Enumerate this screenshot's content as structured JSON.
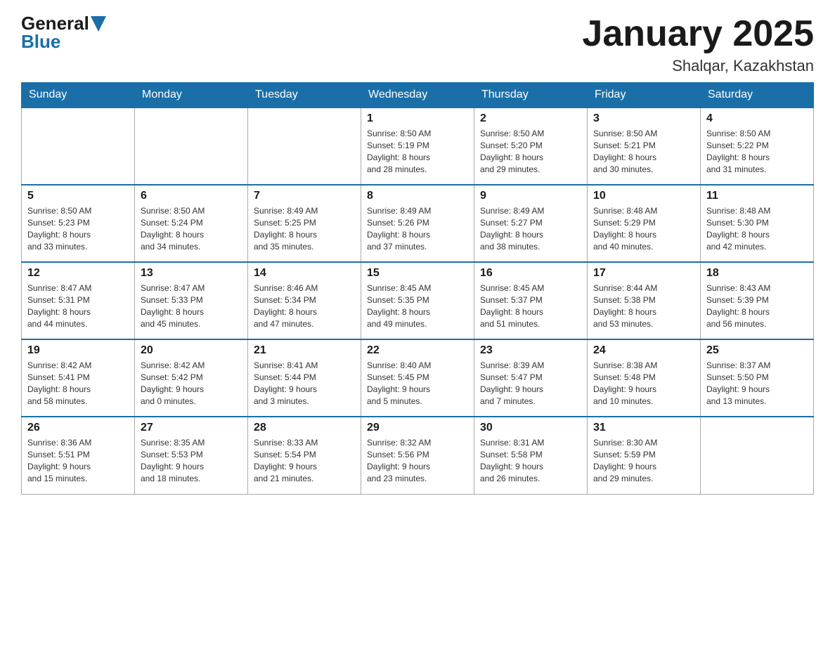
{
  "header": {
    "logo_general": "General",
    "logo_blue": "Blue",
    "month_title": "January 2025",
    "location": "Shalqar, Kazakhstan"
  },
  "weekdays": [
    "Sunday",
    "Monday",
    "Tuesday",
    "Wednesday",
    "Thursday",
    "Friday",
    "Saturday"
  ],
  "weeks": [
    [
      {
        "day": "",
        "info": ""
      },
      {
        "day": "",
        "info": ""
      },
      {
        "day": "",
        "info": ""
      },
      {
        "day": "1",
        "info": "Sunrise: 8:50 AM\nSunset: 5:19 PM\nDaylight: 8 hours\nand 28 minutes."
      },
      {
        "day": "2",
        "info": "Sunrise: 8:50 AM\nSunset: 5:20 PM\nDaylight: 8 hours\nand 29 minutes."
      },
      {
        "day": "3",
        "info": "Sunrise: 8:50 AM\nSunset: 5:21 PM\nDaylight: 8 hours\nand 30 minutes."
      },
      {
        "day": "4",
        "info": "Sunrise: 8:50 AM\nSunset: 5:22 PM\nDaylight: 8 hours\nand 31 minutes."
      }
    ],
    [
      {
        "day": "5",
        "info": "Sunrise: 8:50 AM\nSunset: 5:23 PM\nDaylight: 8 hours\nand 33 minutes."
      },
      {
        "day": "6",
        "info": "Sunrise: 8:50 AM\nSunset: 5:24 PM\nDaylight: 8 hours\nand 34 minutes."
      },
      {
        "day": "7",
        "info": "Sunrise: 8:49 AM\nSunset: 5:25 PM\nDaylight: 8 hours\nand 35 minutes."
      },
      {
        "day": "8",
        "info": "Sunrise: 8:49 AM\nSunset: 5:26 PM\nDaylight: 8 hours\nand 37 minutes."
      },
      {
        "day": "9",
        "info": "Sunrise: 8:49 AM\nSunset: 5:27 PM\nDaylight: 8 hours\nand 38 minutes."
      },
      {
        "day": "10",
        "info": "Sunrise: 8:48 AM\nSunset: 5:29 PM\nDaylight: 8 hours\nand 40 minutes."
      },
      {
        "day": "11",
        "info": "Sunrise: 8:48 AM\nSunset: 5:30 PM\nDaylight: 8 hours\nand 42 minutes."
      }
    ],
    [
      {
        "day": "12",
        "info": "Sunrise: 8:47 AM\nSunset: 5:31 PM\nDaylight: 8 hours\nand 44 minutes."
      },
      {
        "day": "13",
        "info": "Sunrise: 8:47 AM\nSunset: 5:33 PM\nDaylight: 8 hours\nand 45 minutes."
      },
      {
        "day": "14",
        "info": "Sunrise: 8:46 AM\nSunset: 5:34 PM\nDaylight: 8 hours\nand 47 minutes."
      },
      {
        "day": "15",
        "info": "Sunrise: 8:45 AM\nSunset: 5:35 PM\nDaylight: 8 hours\nand 49 minutes."
      },
      {
        "day": "16",
        "info": "Sunrise: 8:45 AM\nSunset: 5:37 PM\nDaylight: 8 hours\nand 51 minutes."
      },
      {
        "day": "17",
        "info": "Sunrise: 8:44 AM\nSunset: 5:38 PM\nDaylight: 8 hours\nand 53 minutes."
      },
      {
        "day": "18",
        "info": "Sunrise: 8:43 AM\nSunset: 5:39 PM\nDaylight: 8 hours\nand 56 minutes."
      }
    ],
    [
      {
        "day": "19",
        "info": "Sunrise: 8:42 AM\nSunset: 5:41 PM\nDaylight: 8 hours\nand 58 minutes."
      },
      {
        "day": "20",
        "info": "Sunrise: 8:42 AM\nSunset: 5:42 PM\nDaylight: 9 hours\nand 0 minutes."
      },
      {
        "day": "21",
        "info": "Sunrise: 8:41 AM\nSunset: 5:44 PM\nDaylight: 9 hours\nand 3 minutes."
      },
      {
        "day": "22",
        "info": "Sunrise: 8:40 AM\nSunset: 5:45 PM\nDaylight: 9 hours\nand 5 minutes."
      },
      {
        "day": "23",
        "info": "Sunrise: 8:39 AM\nSunset: 5:47 PM\nDaylight: 9 hours\nand 7 minutes."
      },
      {
        "day": "24",
        "info": "Sunrise: 8:38 AM\nSunset: 5:48 PM\nDaylight: 9 hours\nand 10 minutes."
      },
      {
        "day": "25",
        "info": "Sunrise: 8:37 AM\nSunset: 5:50 PM\nDaylight: 9 hours\nand 13 minutes."
      }
    ],
    [
      {
        "day": "26",
        "info": "Sunrise: 8:36 AM\nSunset: 5:51 PM\nDaylight: 9 hours\nand 15 minutes."
      },
      {
        "day": "27",
        "info": "Sunrise: 8:35 AM\nSunset: 5:53 PM\nDaylight: 9 hours\nand 18 minutes."
      },
      {
        "day": "28",
        "info": "Sunrise: 8:33 AM\nSunset: 5:54 PM\nDaylight: 9 hours\nand 21 minutes."
      },
      {
        "day": "29",
        "info": "Sunrise: 8:32 AM\nSunset: 5:56 PM\nDaylight: 9 hours\nand 23 minutes."
      },
      {
        "day": "30",
        "info": "Sunrise: 8:31 AM\nSunset: 5:58 PM\nDaylight: 9 hours\nand 26 minutes."
      },
      {
        "day": "31",
        "info": "Sunrise: 8:30 AM\nSunset: 5:59 PM\nDaylight: 9 hours\nand 29 minutes."
      },
      {
        "day": "",
        "info": ""
      }
    ]
  ]
}
